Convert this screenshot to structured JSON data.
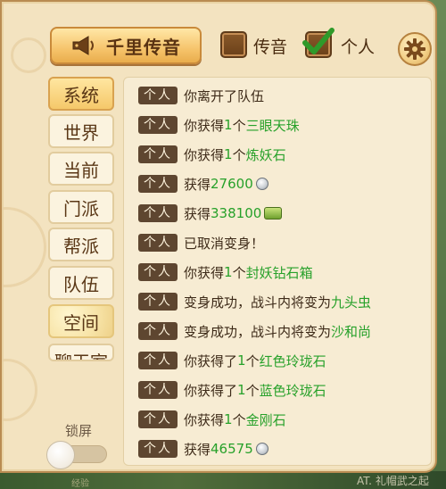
{
  "header": {
    "horn_button_label": "千里传音",
    "filters": [
      {
        "label": "传音",
        "checked": false
      },
      {
        "label": "个人",
        "checked": true
      }
    ]
  },
  "tabs": [
    {
      "label": "系统",
      "active": true
    },
    {
      "label": "世界",
      "active": false
    },
    {
      "label": "当前",
      "active": false
    },
    {
      "label": "门派",
      "active": false
    },
    {
      "label": "帮派",
      "active": false
    },
    {
      "label": "队伍",
      "active": false
    },
    {
      "label": "空间",
      "active": false
    },
    {
      "label": "聊天室",
      "active": false
    }
  ],
  "lock": {
    "label": "锁屏",
    "on": false
  },
  "badge_label": "个人",
  "messages": [
    {
      "prefix": "你离开了队伍",
      "count": "",
      "mid": "",
      "item": "",
      "icon": ""
    },
    {
      "prefix": "你获得",
      "count": "1",
      "mid": "个",
      "item": "三眼天珠",
      "icon": ""
    },
    {
      "prefix": "你获得",
      "count": "1",
      "mid": "个",
      "item": "炼妖石",
      "icon": ""
    },
    {
      "prefix": "获得",
      "count": "27600",
      "mid": "",
      "item": "",
      "icon": "silver-coin"
    },
    {
      "prefix": "获得",
      "count": "338100",
      "mid": "",
      "item": "",
      "icon": "jade-ingot"
    },
    {
      "prefix": "已取消变身！",
      "count": "",
      "mid": "",
      "item": "",
      "icon": ""
    },
    {
      "prefix": "你获得",
      "count": "1",
      "mid": "个",
      "item": "封妖钻石箱",
      "icon": ""
    },
    {
      "prefix": "变身成功，战斗内将变为",
      "count": "",
      "mid": "",
      "item": "九头虫",
      "icon": ""
    },
    {
      "prefix": "变身成功，战斗内将变为",
      "count": "",
      "mid": "",
      "item": "沙和尚",
      "icon": ""
    },
    {
      "prefix": "你获得了",
      "count": "1",
      "mid": "个",
      "item": "红色玲珑石",
      "icon": ""
    },
    {
      "prefix": "你获得了",
      "count": "1",
      "mid": "个",
      "item": "蓝色玲珑石",
      "icon": ""
    },
    {
      "prefix": "你获得",
      "count": "1",
      "mid": "个",
      "item": "金刚石",
      "icon": ""
    },
    {
      "prefix": "获得",
      "count": "46575",
      "mid": "",
      "item": "",
      "icon": "silver-coin"
    }
  ],
  "world_text": "AT. 礼帽武之起",
  "world_left_text": "经验",
  "colors": {
    "highlight": "#27a12a",
    "badge_bg": "#5e4630",
    "panel_bg": "#f3e3c0"
  }
}
